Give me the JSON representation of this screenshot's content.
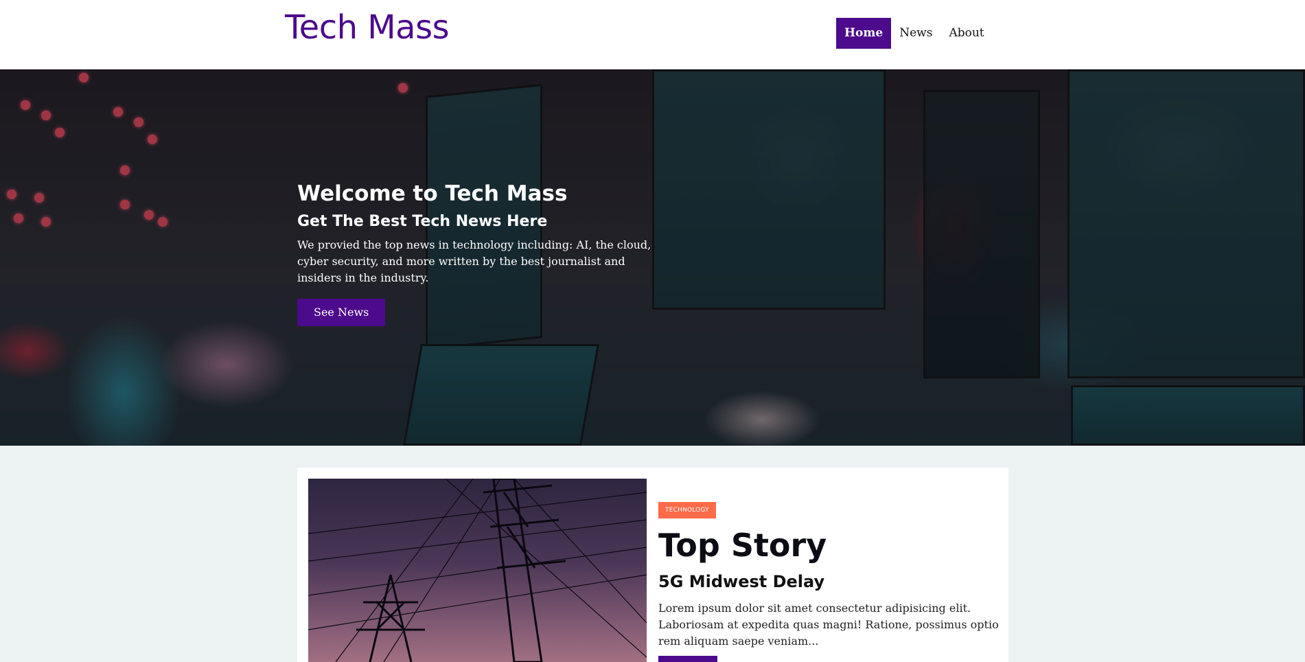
{
  "header": {
    "logo": "Tech Mass",
    "nav": [
      {
        "label": "Home",
        "active": true
      },
      {
        "label": "News",
        "active": false
      },
      {
        "label": "About",
        "active": false
      }
    ]
  },
  "hero": {
    "title": "Welcome to Tech Mass",
    "subtitle": "Get The Best Tech News Here",
    "text": "We provied the top news in technology including: AI, the cloud, cyber security, and more written by the best journalist and insiders in the industry.",
    "button": "See News"
  },
  "top_story": {
    "tag": "TECHNOLOGY",
    "heading": "Top Story",
    "title": "5G Midwest Delay",
    "excerpt": "Lorem ipsum dolor sit amet consectetur adipisicing elit. Laboriosam at expedita quas magni! Ratione, possimus optio rem aliquam saepe veniam..."
  },
  "colors": {
    "brand": "#4c0a8c",
    "tag": "#ff6a48",
    "page_bg": "#ecf1f1"
  }
}
